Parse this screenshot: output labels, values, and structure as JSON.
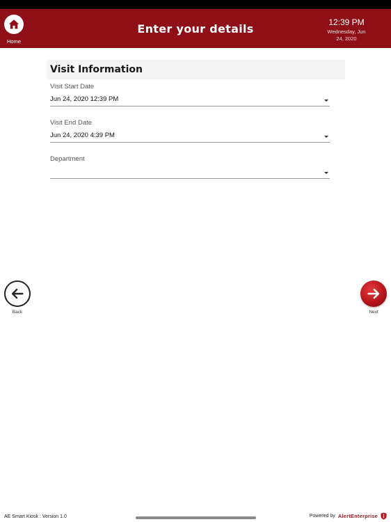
{
  "header": {
    "title": "Enter your details",
    "home_label": "Home",
    "time": "12:39 PM",
    "date_line1": "Wednesday, Jun",
    "date_line2": "24, 2020"
  },
  "section": {
    "title": "Visit Information"
  },
  "fields": {
    "start": {
      "label": "Visit Start Date",
      "value": "Jun 24, 2020 12:39 PM"
    },
    "end": {
      "label": "Visit End Date",
      "value": "Jun 24, 2020 4:39 PM"
    },
    "department": {
      "label": "Department",
      "value": ""
    }
  },
  "nav": {
    "back_label": "Back",
    "next_label": "Next"
  },
  "footer": {
    "version": "AE Smart Kiosk : Version 1.0",
    "powered_by": "Powered by",
    "brand": "AlertEnterprise"
  },
  "colors": {
    "header_bg": "#8e1016",
    "accent": "#b5161b"
  },
  "icons": {
    "home": "home-icon",
    "back": "arrow-left-icon",
    "next": "arrow-right-icon",
    "dropdown": "caret-down-icon",
    "brand": "shield-logo-icon"
  }
}
